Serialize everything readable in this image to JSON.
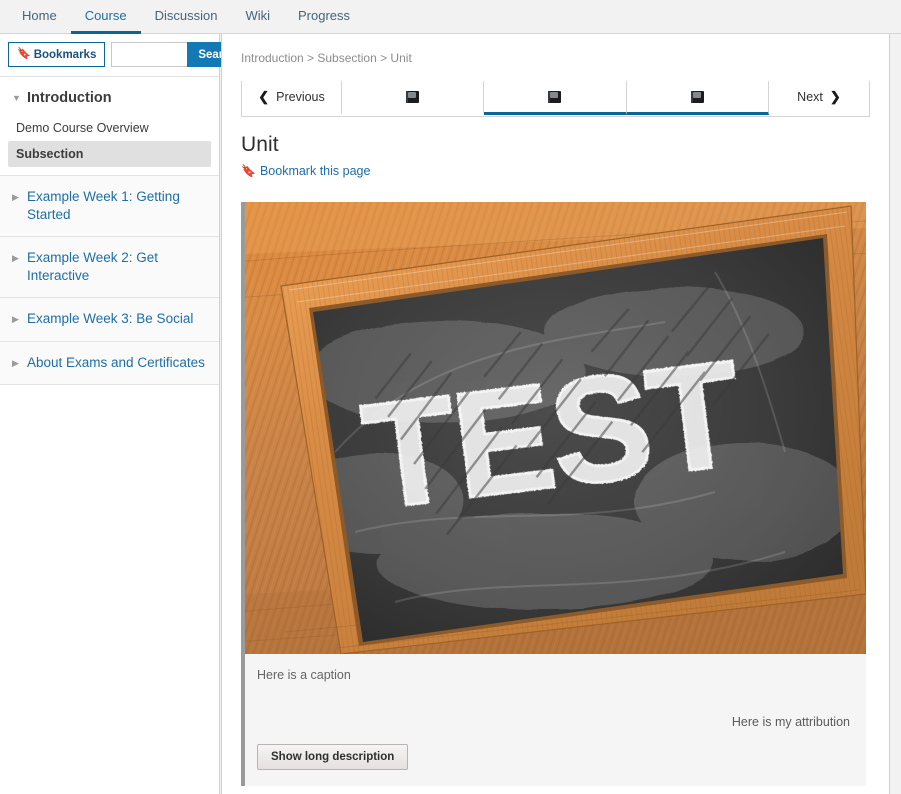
{
  "top_nav": {
    "tabs": [
      {
        "label": "Home",
        "active": false
      },
      {
        "label": "Course",
        "active": true
      },
      {
        "label": "Discussion",
        "active": false
      },
      {
        "label": "Wiki",
        "active": false
      },
      {
        "label": "Progress",
        "active": false
      }
    ]
  },
  "sidebar": {
    "bookmarks_label": "Bookmarks",
    "bookmarks_icon": "bookmark-icon",
    "search_value": "",
    "search_placeholder": "",
    "search_button_label": "Search",
    "chapters": [
      {
        "title": "Introduction",
        "expanded": true,
        "toggle_icon": "caret-down-icon",
        "sections": [
          {
            "label": "Demo Course Overview",
            "active": false
          },
          {
            "label": "Subsection",
            "active": true
          }
        ]
      },
      {
        "title": "Example Week 1: Getting Started",
        "expanded": false,
        "toggle_icon": "caret-right-icon",
        "sections": []
      },
      {
        "title": "Example Week 2: Get Interactive",
        "expanded": false,
        "toggle_icon": "caret-right-icon",
        "sections": []
      },
      {
        "title": "Example Week 3: Be Social",
        "expanded": false,
        "toggle_icon": "caret-right-icon",
        "sections": []
      },
      {
        "title": "About Exams and Certificates",
        "expanded": false,
        "toggle_icon": "caret-right-icon",
        "sections": []
      }
    ]
  },
  "content": {
    "breadcrumb": "Introduction > Subsection > Unit",
    "sequence": {
      "previous_label": "Previous",
      "previous_icon": "chevron-left-icon",
      "next_label": "Next",
      "next_icon": "chevron-right-icon",
      "units": [
        {
          "icon": "book-icon",
          "active": false
        },
        {
          "icon": "book-icon",
          "active": true
        },
        {
          "icon": "book-icon",
          "active": true
        }
      ]
    },
    "unit_title": "Unit",
    "bookmark_link_label": "Bookmark this page",
    "bookmark_link_icon": "bookmark-icon",
    "figure": {
      "image_alt": "Chalkboard in a wooden frame with the word TEST written in chalk",
      "image_word": "TEST",
      "caption": "Here is a caption",
      "attribution": "Here is my attribution",
      "long_description_button": "Show long description"
    }
  },
  "colors": {
    "accent_blue": "#0b6695",
    "link_blue": "#1e6ea5",
    "search_button": "#1279b5",
    "page_bg": "#f2f2f2",
    "caption_bg": "#f5f5f5",
    "figure_bar": "#9a9a9a"
  }
}
